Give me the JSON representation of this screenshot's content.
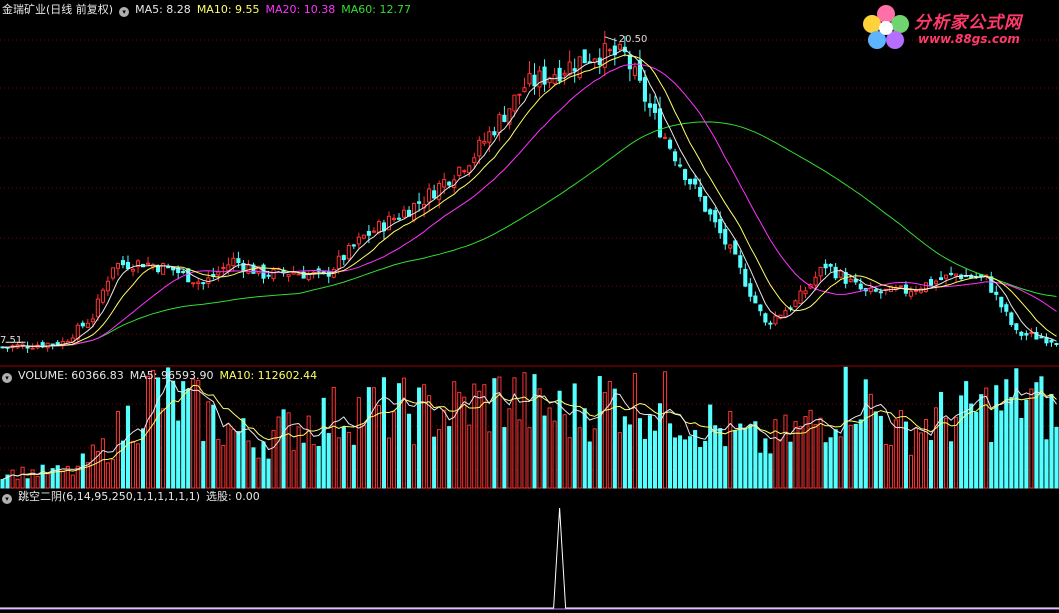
{
  "main_panel": {
    "stock_name": "金瑞矿业(日线 前复权)",
    "indicators": [
      {
        "label": "MA5: 8.28",
        "color": "#e8e8e8"
      },
      {
        "label": "MA10: 9.55",
        "color": "#ffff66"
      },
      {
        "label": "MA20: 10.38",
        "color": "#ff33ff"
      },
      {
        "label": "MA60: 12.77",
        "color": "#33dd33"
      }
    ],
    "high_label": "20.50",
    "low_label": "7.51"
  },
  "volume_panel": {
    "indicators": [
      {
        "label": "VOLUME: 60366.83",
        "color": "#e8e8e8"
      },
      {
        "label": "MA5: 96593.90",
        "color": "#e8e8e8"
      },
      {
        "label": "MA10: 112602.44",
        "color": "#ffff66"
      }
    ]
  },
  "signal_panel": {
    "formula": "跳空二阴(6,14,95,250,1,1,1,1,1,1)",
    "result": "选股: 0.00"
  },
  "watermark": {
    "line1": "分析家公式网",
    "line2": "www.88gs.com"
  },
  "colors": {
    "up": "#ff3333",
    "down": "#55ffff",
    "ma5": "#e8e8e8",
    "ma10": "#ffff66",
    "ma20": "#ff33ff",
    "ma60": "#33dd33",
    "grid": "#8a0000"
  },
  "chart_data": {
    "type": "candlestick",
    "price_anchors": [
      [
        0,
        7.3
      ],
      [
        12,
        7.5
      ],
      [
        18,
        8.6
      ],
      [
        22,
        10.8
      ],
      [
        28,
        10.9
      ],
      [
        34,
        10.6
      ],
      [
        40,
        10.0
      ],
      [
        46,
        11.0
      ],
      [
        52,
        10.4
      ],
      [
        58,
        10.5
      ],
      [
        64,
        10.3
      ],
      [
        72,
        12.0
      ],
      [
        84,
        13.6
      ],
      [
        94,
        15.5
      ],
      [
        104,
        18.4
      ],
      [
        118,
        19.8
      ],
      [
        124,
        19.7
      ],
      [
        130,
        17.0
      ],
      [
        138,
        14.0
      ],
      [
        146,
        11.0
      ],
      [
        152,
        8.3
      ],
      [
        158,
        9.2
      ],
      [
        164,
        10.8
      ],
      [
        172,
        9.6
      ],
      [
        180,
        9.7
      ],
      [
        190,
        10.4
      ],
      [
        196,
        10.2
      ],
      [
        202,
        7.9
      ],
      [
        210,
        7.6
      ]
    ],
    "volume_anchors": [
      [
        0,
        18000
      ],
      [
        14,
        20000
      ],
      [
        20,
        45000
      ],
      [
        30,
        115000
      ],
      [
        38,
        95000
      ],
      [
        50,
        55000
      ],
      [
        60,
        78000
      ],
      [
        72,
        95000
      ],
      [
        86,
        90000
      ],
      [
        100,
        108000
      ],
      [
        112,
        88000
      ],
      [
        122,
        110000
      ],
      [
        132,
        98000
      ],
      [
        144,
        68000
      ],
      [
        152,
        52000
      ],
      [
        162,
        78000
      ],
      [
        170,
        118000
      ],
      [
        178,
        65000
      ],
      [
        188,
        85000
      ],
      [
        196,
        95000
      ],
      [
        204,
        110000
      ],
      [
        210,
        84000
      ]
    ],
    "signal": {
      "index": 111,
      "value": 1
    },
    "y_marks": {
      "high": 20.5,
      "low": 7.51
    },
    "count": 211
  }
}
